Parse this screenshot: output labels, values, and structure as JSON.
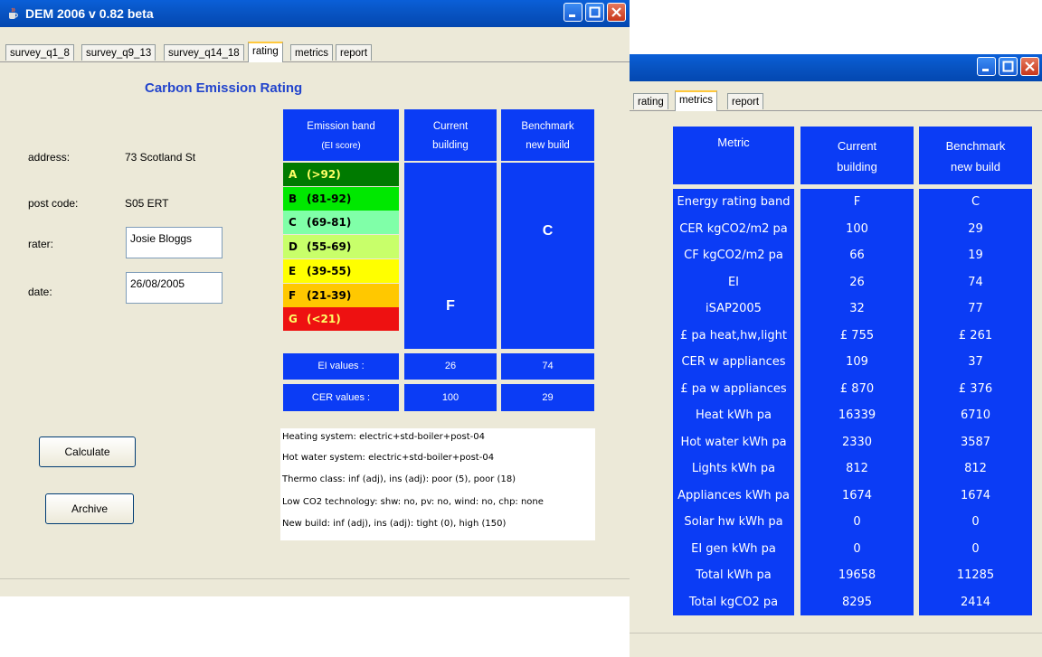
{
  "colors": {
    "title_bar": "#0854C3",
    "panel_blue": "#0B3CF5",
    "window_bg": "#ECE9D8",
    "heading": "#2244cc"
  },
  "window1": {
    "title": "DEM 2006 v 0.82 beta",
    "tabs": [
      "survey_q1_8",
      "survey_q9_13",
      "survey_q14_18",
      "rating",
      "metrics",
      "report"
    ],
    "active_tab": "rating",
    "heading": "Carbon Emission Rating",
    "form": {
      "address_label": "address:",
      "address_value": "73 Scotland St",
      "postcode_label": "post code:",
      "postcode_value": "S05 ERT",
      "rater_label": "rater:",
      "rater_value": "Josie Bloggs",
      "date_label": "date:",
      "date_value": "26/08/2005"
    },
    "buttons": {
      "calculate": "Calculate",
      "archive": "Archive"
    },
    "table": {
      "headers": [
        "Emission band",
        "(EI score)",
        "Current",
        "building",
        "Benchmark",
        "new build"
      ],
      "bands": [
        {
          "letter": "A",
          "range": "(>92)",
          "color": "#007A00",
          "text_color": "#FFFF66"
        },
        {
          "letter": "B",
          "range": "(81-92)",
          "color": "#00E800",
          "text_color": "#000000"
        },
        {
          "letter": "C",
          "range": "(69-81)",
          "color": "#80FFA8",
          "text_color": "#000000"
        },
        {
          "letter": "D",
          "range": "(55-69)",
          "color": "#C8FF6A",
          "text_color": "#000000"
        },
        {
          "letter": "E",
          "range": "(39-55)",
          "color": "#FFFF00",
          "text_color": "#000000"
        },
        {
          "letter": "F",
          "range": "(21-39)",
          "color": "#FFC800",
          "text_color": "#000000"
        },
        {
          "letter": "G",
          "range": "(<21)",
          "color": "#EE1111",
          "text_color": "#FFFF66"
        }
      ],
      "current_rating": "F",
      "benchmark_rating": "C",
      "ei_label": "EI values :",
      "ei_current": "26",
      "ei_benchmark": "74",
      "cer_label": "CER values :",
      "cer_current": "100",
      "cer_benchmark": "29"
    },
    "info_lines": [
      "Heating system:   electric+std-boiler+post-04",
      "Hot water system:   electric+std-boiler+post-04",
      "Thermo class: inf (adj), ins (adj):  poor  (5),  poor  (18)",
      "Low CO2 technology: shw: no,  pv: no,  wind: no,  chp: none",
      "New build:   inf (adj), ins (adj):  tight  (0),  high  (150)"
    ]
  },
  "window2": {
    "tabs": [
      "rating",
      "metrics",
      "report"
    ],
    "active_tab": "metrics",
    "headers": {
      "metric": "Metric",
      "current_1": "Current",
      "current_2": "building",
      "bench_1": "Benchmark",
      "bench_2": "new build"
    },
    "rows": [
      {
        "metric": "Energy rating band",
        "current": "F",
        "benchmark": "C"
      },
      {
        "metric": "CER kgCO2/m2 pa",
        "current": "100",
        "benchmark": "29"
      },
      {
        "metric": "CF kgCO2/m2 pa",
        "current": "66",
        "benchmark": "19"
      },
      {
        "metric": "EI",
        "current": "26",
        "benchmark": "74"
      },
      {
        "metric": "iSAP2005",
        "current": "32",
        "benchmark": "77"
      },
      {
        "metric": "£ pa heat,hw,light",
        "current": "£ 755",
        "benchmark": "£ 261"
      },
      {
        "metric": "CER w appliances",
        "current": "109",
        "benchmark": "37"
      },
      {
        "metric": "£ pa w appliances",
        "current": "£ 870",
        "benchmark": "£ 376"
      },
      {
        "metric": "Heat kWh pa",
        "current": "16339",
        "benchmark": "6710"
      },
      {
        "metric": "Hot water kWh pa",
        "current": "2330",
        "benchmark": "3587"
      },
      {
        "metric": "Lights kWh pa",
        "current": "812",
        "benchmark": "812"
      },
      {
        "metric": "Appliances kWh pa",
        "current": "1674",
        "benchmark": "1674"
      },
      {
        "metric": "Solar hw kWh pa",
        "current": "0",
        "benchmark": "0"
      },
      {
        "metric": "EI gen kWh pa",
        "current": "0",
        "benchmark": "0"
      },
      {
        "metric": "Total kWh pa",
        "current": "19658",
        "benchmark": "11285"
      },
      {
        "metric": "Total kgCO2 pa",
        "current": "8295",
        "benchmark": "2414"
      }
    ]
  }
}
